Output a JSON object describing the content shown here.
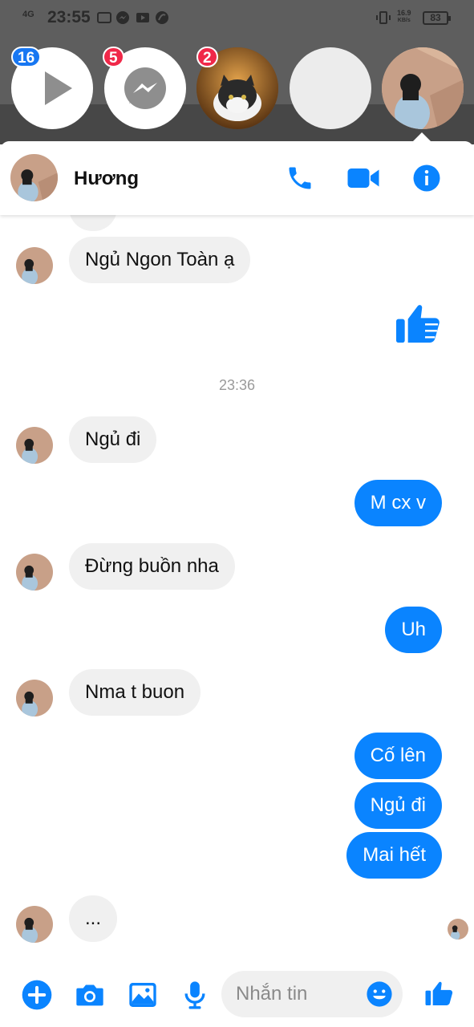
{
  "status_bar": {
    "network": "4G",
    "time": "23:55",
    "speed_top": "16.9",
    "speed_unit": "KB/s",
    "battery": "83"
  },
  "chat_heads": {
    "items": [
      {
        "kind": "video-icon",
        "badge": "16",
        "badge_color": "#1877f2"
      },
      {
        "kind": "messenger-icon",
        "badge": "5",
        "badge_color": "#f02849"
      },
      {
        "kind": "cat-photo",
        "badge": "2",
        "badge_color": "#f02849"
      },
      {
        "kind": "blank-avatar"
      },
      {
        "kind": "profile-photo",
        "active": true
      }
    ]
  },
  "header": {
    "name": "Hương",
    "icons": [
      "phone-icon",
      "video-call-icon",
      "info-icon"
    ]
  },
  "colors": {
    "accent": "#0a84ff",
    "incoming_bubble": "#f0f0f0"
  },
  "messages": {
    "m0": "...",
    "m1": "Ngủ Ngon Toàn ạ",
    "like_icon": "thumbs-up-icon",
    "timestamp": "23:36",
    "m2": "Ngủ đi",
    "m3": "M cx v",
    "m4": "Đừng buồn nha",
    "m5": "Uh",
    "m6": "Nma t buon",
    "m7": "Cố lên",
    "m8": "Ngủ đi",
    "m9": "Mai hết",
    "typing": "..."
  },
  "composer": {
    "placeholder": "Nhắn tin",
    "icons": [
      "plus-icon",
      "camera-icon",
      "gallery-icon",
      "microphone-icon",
      "emoji-icon",
      "thumbs-up-icon"
    ]
  }
}
